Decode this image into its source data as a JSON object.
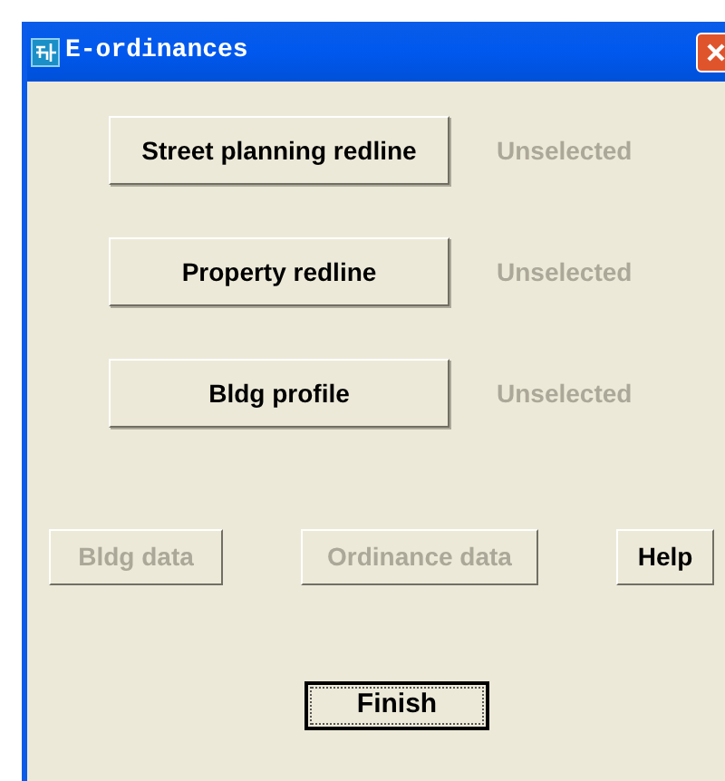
{
  "window": {
    "title": "E-ordinances"
  },
  "layers": [
    {
      "button": "Street planning redline",
      "status": "Unselected"
    },
    {
      "button": "Property redline",
      "status": "Unselected"
    },
    {
      "button": "Bldg profile",
      "status": "Unselected"
    }
  ],
  "actions": [
    {
      "label": "Bldg data",
      "disabled": true
    },
    {
      "label": "Ordinance data",
      "disabled": true
    },
    {
      "label": "Help",
      "disabled": false
    }
  ],
  "finish": {
    "label": "Finish",
    "focused": true
  }
}
